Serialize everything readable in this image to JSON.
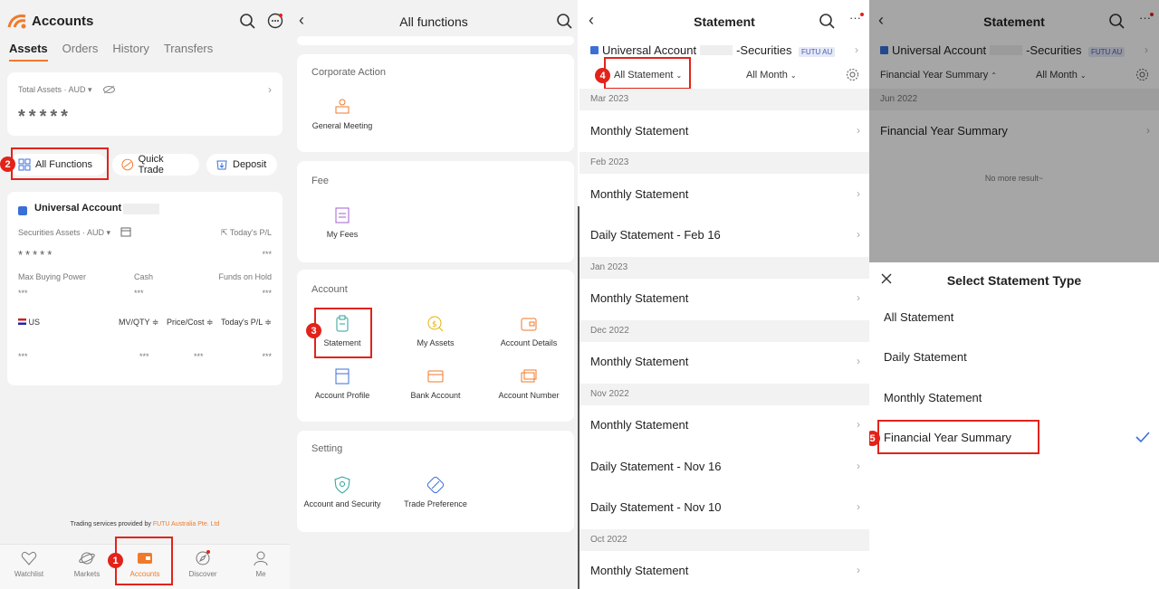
{
  "panel1": {
    "title": "Accounts",
    "tabs": [
      "Assets",
      "Orders",
      "History",
      "Transfers"
    ],
    "total_assets_label": "Total Assets · AUD ▾",
    "total_assets_value": "*****",
    "actions": {
      "all_functions": "All Functions",
      "quick_trade": "Quick Trade",
      "deposit": "Deposit"
    },
    "account": {
      "name": "Universal Account",
      "securities_label": "Securities Assets · AUD ▾",
      "todays_pl_label": "Today's P/L",
      "securities_value": "*****",
      "todays_pl_value": "***",
      "max_buying_power_label": "Max Buying Power",
      "cash_label": "Cash",
      "funds_on_hold_label": "Funds on Hold",
      "max_buying_power_value": "***",
      "cash_value": "***",
      "funds_on_hold_value": "***",
      "market_label": "US",
      "col_mv": "MV/QTY ≑",
      "col_price": "Price/Cost ≑",
      "col_pl": "Today's P/L ≑",
      "row_v1": "***",
      "row_v2": "***",
      "row_v3": "***",
      "row_v4": "***"
    },
    "footer_note": "Trading services provided by",
    "footer_company": "FUTU Australia Pte. Ltd",
    "nav": [
      "Watchlist",
      "Markets",
      "Accounts",
      "Discover",
      "Me"
    ],
    "badges": [
      "1",
      "2"
    ]
  },
  "panel2": {
    "title": "All functions",
    "sections": {
      "corporate_action": {
        "title": "Corporate Action",
        "items": [
          "General Meeting"
        ]
      },
      "fee": {
        "title": "Fee",
        "items": [
          "My Fees"
        ]
      },
      "account": {
        "title": "Account",
        "items": [
          "Statement",
          "My Assets",
          "Account Details",
          "Account Profile",
          "Bank Account",
          "Account Number"
        ]
      },
      "setting": {
        "title": "Setting",
        "items": [
          "Account and Security",
          "Trade Preference"
        ]
      }
    },
    "badge": "3"
  },
  "panel3": {
    "title": "Statement",
    "account_name": "Universal Account",
    "account_suffix": "-Securities",
    "futu_tag": "FUTU AU",
    "filter_type": "All Statement",
    "filter_month": "All Month",
    "badge": "4",
    "groups": [
      {
        "month": "Mar 2023",
        "rows": [
          "Monthly Statement"
        ]
      },
      {
        "month": "Feb 2023",
        "rows": [
          "Monthly Statement",
          "Daily Statement - Feb 16"
        ]
      },
      {
        "month": "Jan 2023",
        "rows": [
          "Monthly Statement"
        ]
      },
      {
        "month": "Dec 2022",
        "rows": [
          "Monthly Statement"
        ]
      },
      {
        "month": "Nov 2022",
        "rows": [
          "Monthly Statement",
          "Daily Statement - Nov 16",
          "Daily Statement - Nov 10"
        ]
      },
      {
        "month": "Oct 2022",
        "rows": [
          "Monthly Statement"
        ]
      }
    ]
  },
  "panel4": {
    "title": "Statement",
    "account_name": "Universal Account",
    "account_suffix": "-Securities",
    "futu_tag": "FUTU AU",
    "filter_type": "Financial Year Summary",
    "filter_month": "All Month",
    "month": "Jun 2022",
    "row": "Financial Year Summary",
    "no_more": "No more result~",
    "sheet_title": "Select Statement Type",
    "options": [
      "All Statement",
      "Daily Statement",
      "Monthly Statement",
      "Financial Year Summary"
    ],
    "badge": "5"
  },
  "colors": {
    "accent": "#f07a2a",
    "highlight": "#e2231a",
    "check": "#3b6fd8"
  }
}
